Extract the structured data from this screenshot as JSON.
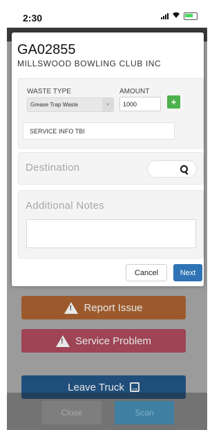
{
  "status_bar": {
    "time": "2:30"
  },
  "modal": {
    "job_id": "GA02855",
    "customer_name": "MILLSWOOD BOWLING CLUB INC",
    "waste_type_label": "WASTE TYPE",
    "waste_type_value": "Grease Trap Waste",
    "amount_label": "AMOUNT",
    "amount_value": "1000",
    "add_label": "+",
    "service_info": "SERVICE INFO TBI",
    "destination_label": "Destination",
    "notes_label": "Additional Notes",
    "cancel_label": "Cancel",
    "next_label": "Next"
  },
  "background": {
    "report_issue_label": "Report Issue",
    "service_problem_label": "Service Problem",
    "leave_truck_label": "Leave Truck",
    "close_label": "Close",
    "scan_label": "Scan"
  },
  "colors": {
    "accent_blue": "#2f74b5",
    "add_green": "#4cb14c",
    "report_orange": "#9c5a2c",
    "service_red": "#9e4455",
    "leave_blue": "#1f4e7a"
  }
}
